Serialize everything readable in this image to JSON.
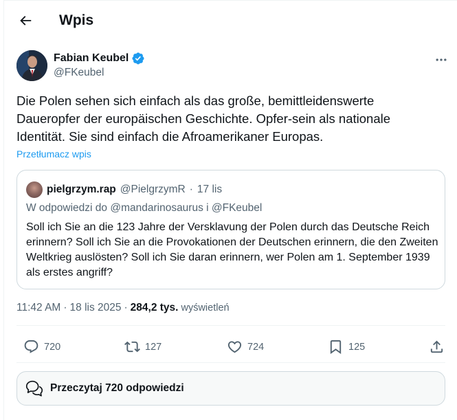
{
  "header": {
    "title": "Wpis",
    "back_icon": "arrow-left-icon"
  },
  "author": {
    "name": "Fabian Keubel",
    "handle": "@FKeubel",
    "verified": true,
    "verified_color": "#1d9bf0"
  },
  "tweet": {
    "text": "Die Polen sehen sich einfach als das große, bemittleidenswerte Daueropfer der europäischen Geschichte. Opfer-sein als nationale Identität. Sie sind einfach die Afroamerikaner Europas.",
    "translate_label": "Przetłumacz wpis"
  },
  "quote": {
    "name": "pielgrzym.rap",
    "handle": "@PielgrzymR",
    "separator": "·",
    "date": "17 lis",
    "reply_to": "W odpowiedzi do @mandarinosaurus i @FKeubel",
    "text": "Soll ich Sie an die 123 Jahre der Versklavung der Polen durch das Deutsche Reich erinnern? Soll ich Sie an die Provokationen der Deutschen erinnern, die den Zweiten Weltkrieg auslösten? Soll ich Sie daran erinnern, wer Polen am 1. September 1939 als erstes angriff?"
  },
  "meta": {
    "time": "11:42 AM",
    "separator": "·",
    "date": "18 lis 2025",
    "views": "284,2 tys.",
    "views_label": "wyświetleń"
  },
  "actions": {
    "replies": "720",
    "reposts": "127",
    "likes": "724",
    "bookmarks": "125"
  },
  "read_replies": {
    "label": "Przeczytaj 720 odpowiedzi"
  },
  "colors": {
    "accent": "#1d9bf0",
    "text": "#0f1419",
    "muted": "#536471",
    "border": "#cfd9de"
  }
}
